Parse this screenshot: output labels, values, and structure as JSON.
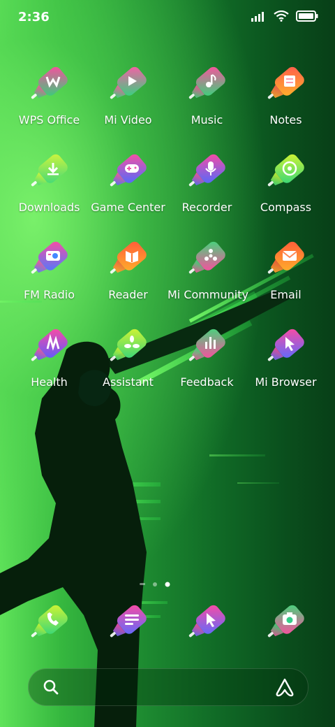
{
  "status": {
    "time": "2:36"
  },
  "apps": [
    {
      "label": "WPS Office",
      "icon": "wps-office-icon",
      "c1": "#ff4aa0",
      "c2": "#33d17a"
    },
    {
      "label": "Mi Video",
      "icon": "play-icon",
      "c1": "#ff5aa8",
      "c2": "#2fd67d"
    },
    {
      "label": "Music",
      "icon": "music-note-icon",
      "c1": "#ff4f9f",
      "c2": "#34d67a"
    },
    {
      "label": "Notes",
      "icon": "notes-icon",
      "c1": "#ff5c4d",
      "c2": "#ffb32a"
    },
    {
      "label": "Downloads",
      "icon": "download-icon",
      "c1": "#d4f53a",
      "c2": "#3fd97a"
    },
    {
      "label": "Game Center",
      "icon": "gamepad-icon",
      "c1": "#ff4f9f",
      "c2": "#4a6cff"
    },
    {
      "label": "Recorder",
      "icon": "microphone-icon",
      "c1": "#ff4aa0",
      "c2": "#4c6bff"
    },
    {
      "label": "Compass",
      "icon": "compass-icon",
      "c1": "#d6f530",
      "c2": "#34d67a"
    },
    {
      "label": "FM Radio",
      "icon": "radio-icon",
      "c1": "#ff4aa0",
      "c2": "#4c7bff"
    },
    {
      "label": "Reader",
      "icon": "book-icon",
      "c1": "#ff5a3a",
      "c2": "#ffb02a"
    },
    {
      "label": "Mi Community",
      "icon": "community-icon",
      "c1": "#3fd97a",
      "c2": "#ff4aa0"
    },
    {
      "label": "Email",
      "icon": "envelope-icon",
      "c1": "#ff5a3a",
      "c2": "#ffb02a"
    },
    {
      "label": "Health",
      "icon": "health-icon",
      "c1": "#ff4aa0",
      "c2": "#5b5bff"
    },
    {
      "label": "Assistant",
      "icon": "assistant-icon",
      "c1": "#d6f530",
      "c2": "#34d67a"
    },
    {
      "label": "Feedback",
      "icon": "feedback-bars-icon",
      "c1": "#3fd97a",
      "c2": "#ff4aa0"
    },
    {
      "label": "Mi Browser",
      "icon": "cursor-icon",
      "c1": "#ff4aa0",
      "c2": "#5b6bff"
    }
  ],
  "dock": [
    {
      "icon": "phone-icon",
      "c1": "#d6f530",
      "c2": "#34d67a"
    },
    {
      "icon": "messages-icon",
      "c1": "#ff4aa0",
      "c2": "#5b6bff"
    },
    {
      "icon": "browser-cursor-icon",
      "c1": "#ff4aa0",
      "c2": "#5b6bff"
    },
    {
      "icon": "camera-icon",
      "c1": "#3fd97a",
      "c2": "#ff4aa0"
    }
  ],
  "page_indicator": {
    "pages": 2,
    "current": 2
  }
}
